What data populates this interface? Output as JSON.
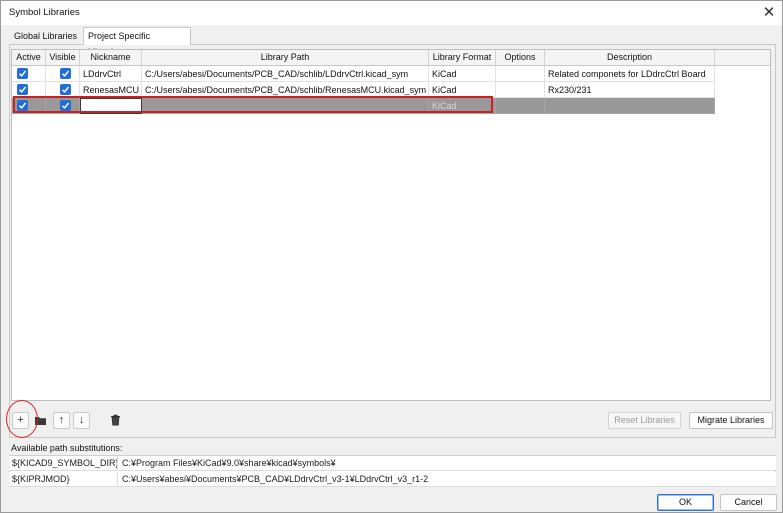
{
  "window": {
    "title": "Symbol Libraries",
    "close_glyph": "✕"
  },
  "tabs": [
    {
      "label": "Global Libraries",
      "active": false
    },
    {
      "label": "Project Specific Libraries",
      "active": true
    }
  ],
  "table": {
    "columns": [
      "Active",
      "Visible",
      "Nickname",
      "Library Path",
      "Library Format",
      "Options",
      "Description"
    ],
    "rows": [
      {
        "active": true,
        "visible": true,
        "nickname": "LDdrvCtrl",
        "path": "C:/Users/abesi/Documents/PCB_CAD/schlib/LDdrvCtrl.kicad_sym",
        "format": "KiCad",
        "options": "",
        "description": "Related componets for LDdrcCtrl Board",
        "selected": false
      },
      {
        "active": true,
        "visible": true,
        "nickname": "RenesasMCU",
        "path": "C:/Users/abesi/Documents/PCB_CAD/schlib/RenesasMCU.kicad_sym",
        "format": "KiCad",
        "options": "",
        "description": "Rx230/231",
        "selected": false
      },
      {
        "active": true,
        "visible": true,
        "nickname": "",
        "path": "",
        "format": "KiCad",
        "options": "",
        "description": "",
        "selected": true
      }
    ]
  },
  "toolbar": {
    "add_glyph": "+",
    "folder_icon": "folder-icon",
    "up_glyph": "↑",
    "down_glyph": "↓",
    "delete_icon": "trash-icon",
    "reset_label": "Reset Libraries",
    "migrate_label": "Migrate Libraries"
  },
  "substitutions": {
    "heading": "Available path substitutions:",
    "items": [
      {
        "name": "${KICAD9_SYMBOL_DIR}",
        "value": "C:¥Program Files¥KiCad¥9.0¥share¥kicad¥symbols¥"
      },
      {
        "name": "${KIPRJMOD}",
        "value": "C:¥Users¥abesi¥Documents¥PCB_CAD¥LDdrvCtrl_v3-1¥LDdrvCtrl_v3_r1-2"
      }
    ]
  },
  "footer": {
    "ok_label": "OK",
    "cancel_label": "Cancel"
  },
  "colors": {
    "accent": "#1f6fd6",
    "annotation": "#cc1f1f",
    "selected_row": "#999999"
  }
}
